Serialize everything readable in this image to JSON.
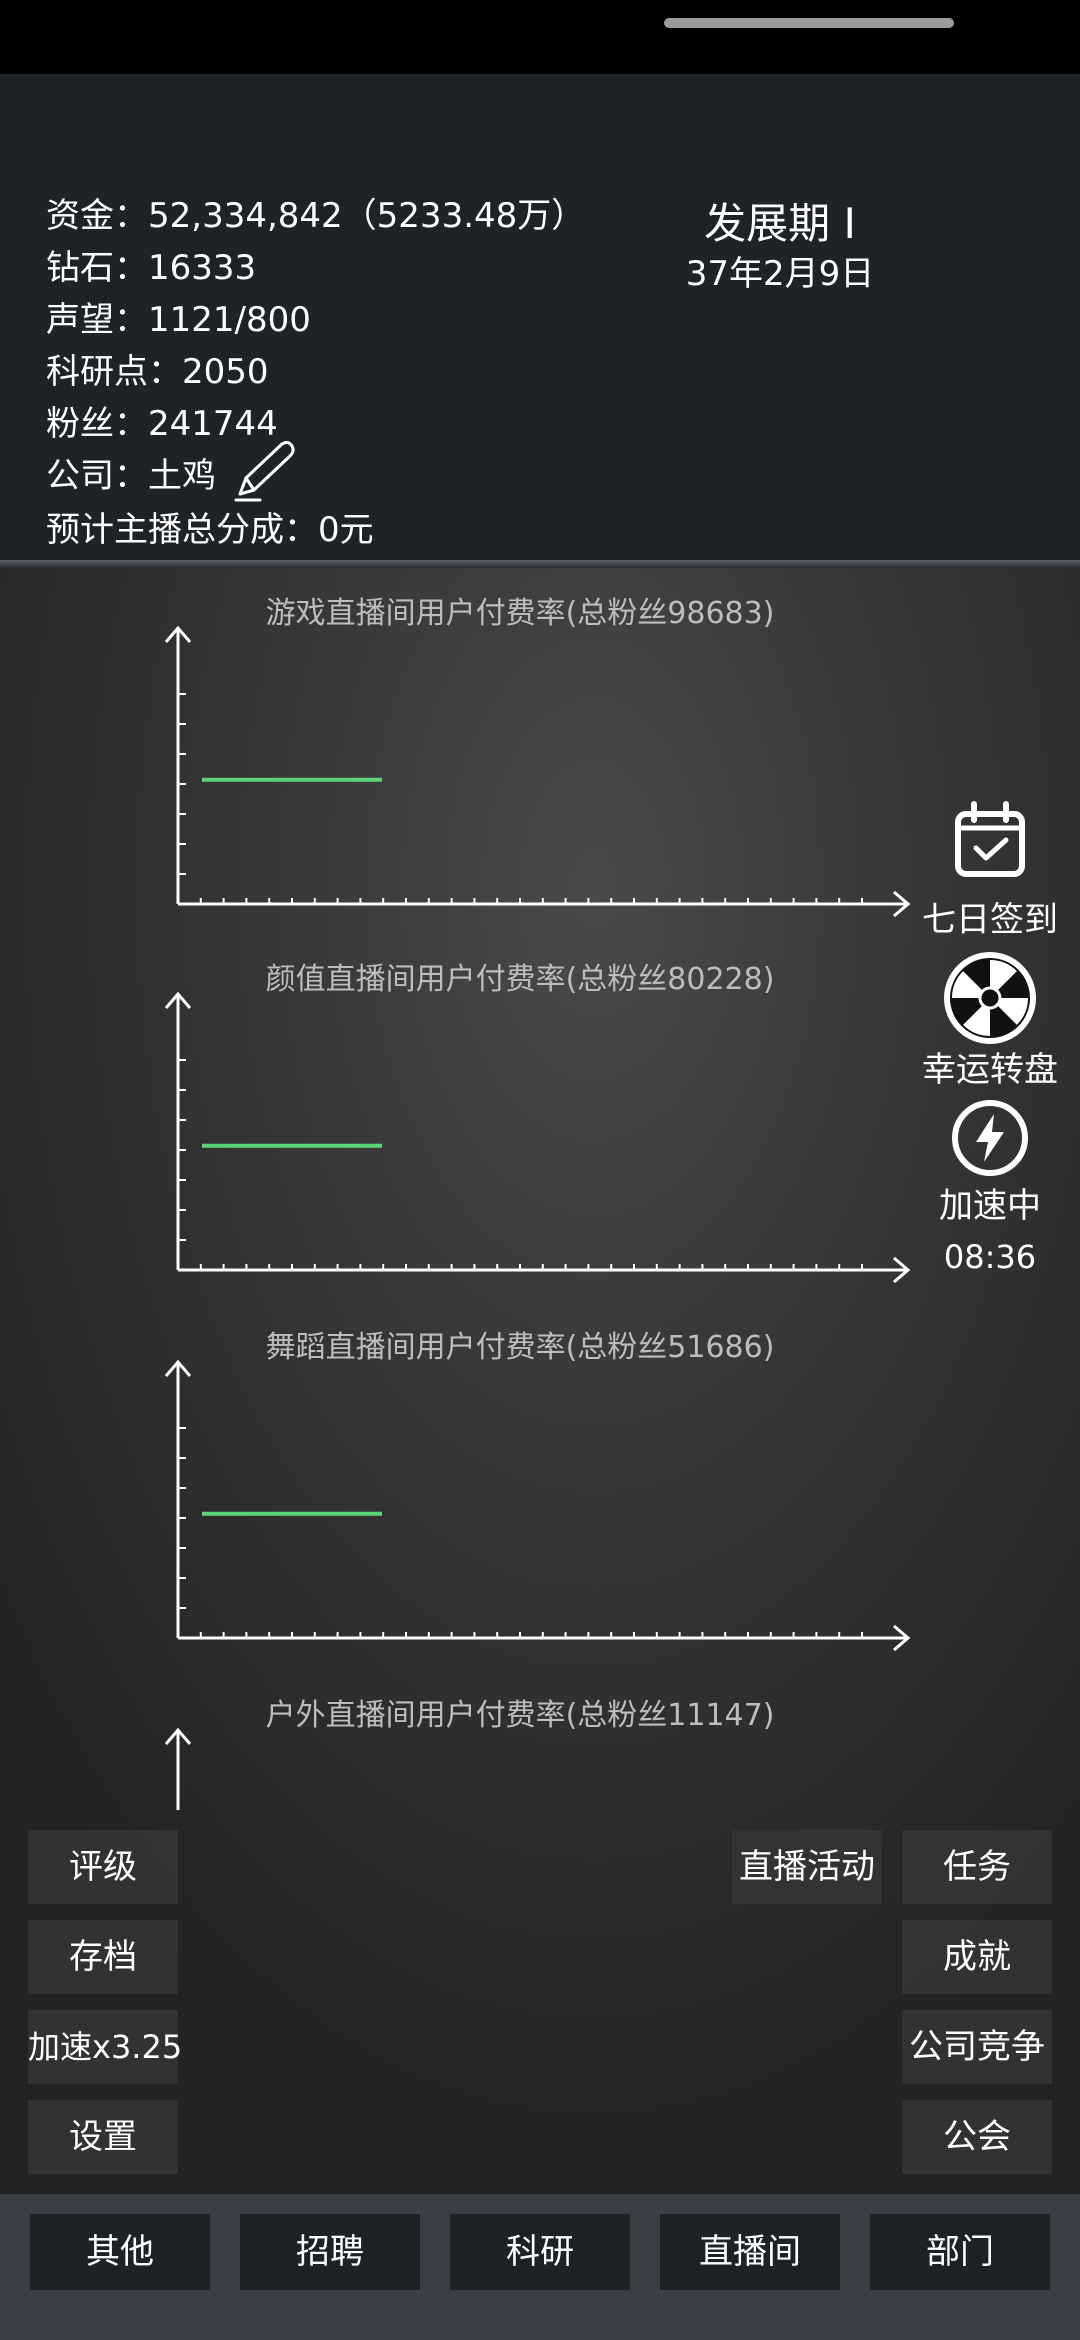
{
  "stats": {
    "funds": "资金：52,334,842（5233.48万）",
    "diamonds": "钻石：16333",
    "reputation": "声望：1121/800",
    "research": "科研点：2050",
    "fans": "粉丝：241744",
    "company": "公司：土鸡",
    "anchor_share": "预计主播总分成：0元"
  },
  "stage": {
    "title": "发展期 I",
    "date": "37年2月9日"
  },
  "charts": [
    {
      "title": "游戏直播间用户付费率(总粉丝98683)"
    },
    {
      "title": "颜值直播间用户付费率(总粉丝80228)"
    },
    {
      "title": "舞蹈直播间用户付费率(总粉丝51686)"
    },
    {
      "title": "户外直播间用户付费率(总粉丝11147)"
    }
  ],
  "chart_data": [
    {
      "type": "line",
      "title": "游戏直播间用户付费率(总粉丝98683)",
      "series_color": "#5fd37a",
      "y_level": 0.45,
      "x_span": [
        0.0,
        0.25
      ],
      "grid": false
    },
    {
      "type": "line",
      "title": "颜值直播间用户付费率(总粉丝80228)",
      "series_color": "#5fd37a",
      "y_level": 0.45,
      "x_span": [
        0.0,
        0.25
      ],
      "grid": false
    },
    {
      "type": "line",
      "title": "舞蹈直播间用户付费率(总粉丝51686)",
      "series_color": "#5fd37a",
      "y_level": 0.45,
      "x_span": [
        0.0,
        0.25
      ],
      "grid": false
    },
    {
      "type": "line",
      "title": "户外直播间用户付费率(总粉丝11147)",
      "series_color": "#5fd37a",
      "grid": false
    }
  ],
  "side": {
    "checkin": {
      "label": "七日签到",
      "icon": "calendar-check-icon"
    },
    "wheel": {
      "label": "幸运转盘",
      "icon": "lucky-wheel-icon"
    },
    "speed": {
      "label": "加速中",
      "timer": "08:36",
      "icon": "lightning-icon"
    }
  },
  "left_menu": {
    "rating": "评级",
    "save": "存档",
    "speed": "加速x3.25",
    "settings": "设置"
  },
  "right_menu": {
    "live_event": "直播活动",
    "tasks": "任务",
    "achievements": "成就",
    "competition": "公司竞争",
    "guild": "公会"
  },
  "nav": {
    "other": "其他",
    "recruit": "招聘",
    "research": "科研",
    "live_room": "直播间",
    "department": "部门"
  },
  "colors": {
    "accent_line": "#5fd37a",
    "header_bg": "#1e2328",
    "nav_bg": "#3a3f45"
  }
}
